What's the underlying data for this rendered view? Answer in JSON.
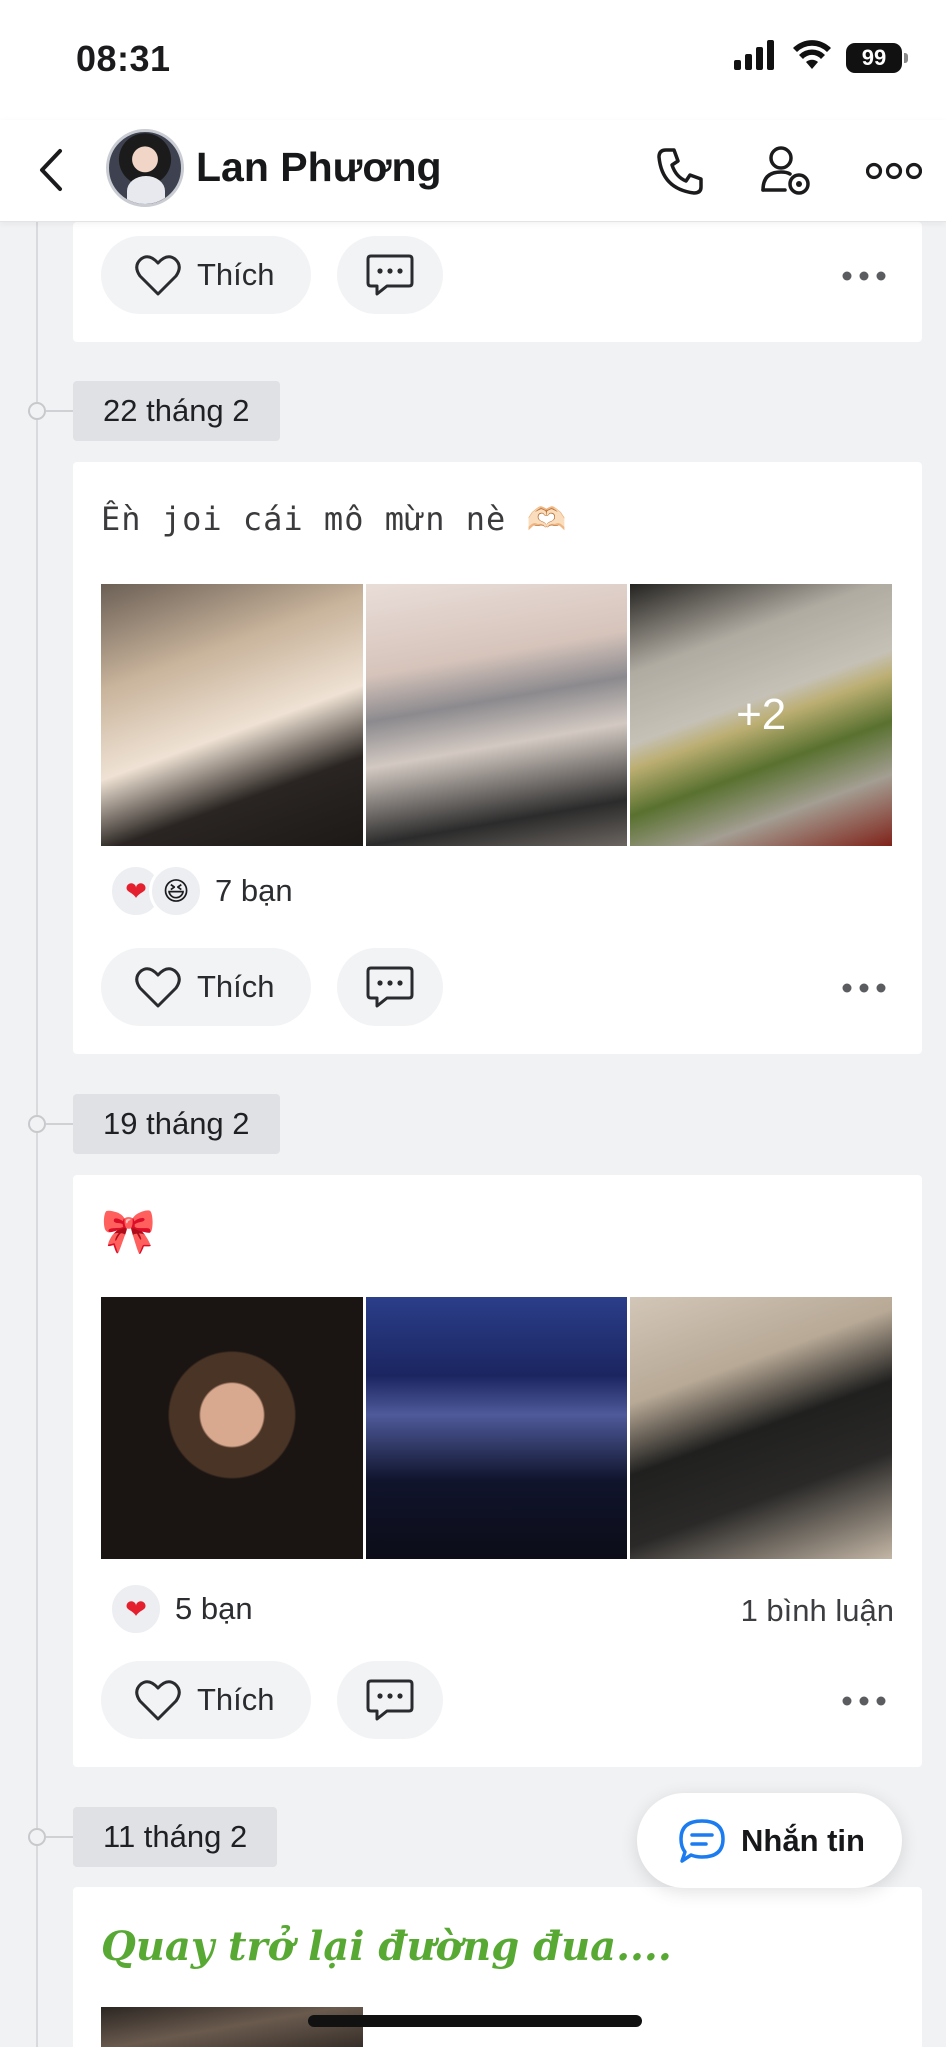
{
  "status_bar": {
    "time": "08:31",
    "battery": "99"
  },
  "header": {
    "contact_name": "Lan Phương"
  },
  "top_card": {
    "like_label": "Thích"
  },
  "posts": [
    {
      "date": "22 tháng 2",
      "text": "Ền joi cái mô mừn nè 🫶🏻",
      "more_photos": "+2",
      "reaction_count": "7 bạn",
      "like_label": "Thích"
    },
    {
      "date": "19 tháng 2",
      "text": "🎀",
      "reaction_count": "5 bạn",
      "comment_count": "1 bình luận",
      "like_label": "Thích"
    },
    {
      "date": "11 tháng 2",
      "text": "Quay trở lại đường đua...."
    }
  ],
  "fab": {
    "label": "Nhắn tin"
  },
  "colors": {
    "accent_blue": "#1a7cf0",
    "title_green": "#58a934",
    "heart_red": "#e5202e"
  }
}
